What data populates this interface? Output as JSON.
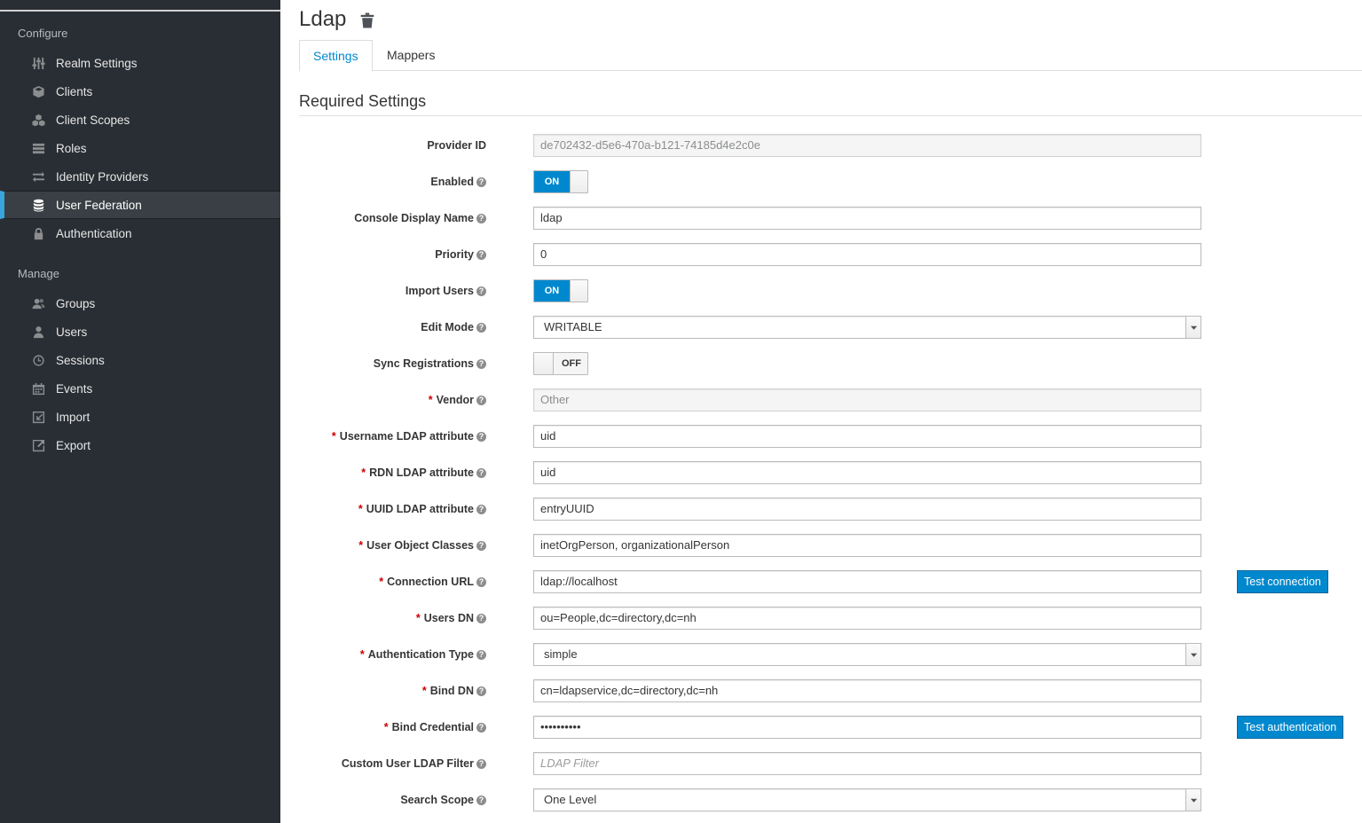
{
  "sidebar": {
    "configure_title": "Configure",
    "manage_title": "Manage",
    "configure_items": [
      {
        "label": "Realm Settings",
        "icon": "sliders-icon"
      },
      {
        "label": "Clients",
        "icon": "cube-icon"
      },
      {
        "label": "Client Scopes",
        "icon": "cubes-icon"
      },
      {
        "label": "Roles",
        "icon": "list-icon"
      },
      {
        "label": "Identity Providers",
        "icon": "exchange-icon"
      },
      {
        "label": "User Federation",
        "icon": "database-icon",
        "active": true
      },
      {
        "label": "Authentication",
        "icon": "lock-icon"
      }
    ],
    "manage_items": [
      {
        "label": "Groups",
        "icon": "users-icon"
      },
      {
        "label": "Users",
        "icon": "user-icon"
      },
      {
        "label": "Sessions",
        "icon": "clock-icon"
      },
      {
        "label": "Events",
        "icon": "calendar-icon"
      },
      {
        "label": "Import",
        "icon": "import-icon"
      },
      {
        "label": "Export",
        "icon": "export-icon"
      }
    ]
  },
  "page": {
    "title": "Ldap",
    "tabs": [
      {
        "label": "Settings",
        "active": true
      },
      {
        "label": "Mappers",
        "active": false
      }
    ],
    "section_heading": "Required Settings"
  },
  "form": {
    "provider_id": {
      "label": "Provider ID",
      "value": "de702432-d5e6-470a-b121-74185d4e2c0e"
    },
    "enabled": {
      "label": "Enabled",
      "state": "ON"
    },
    "console_display_name": {
      "label": "Console Display Name",
      "value": "ldap"
    },
    "priority": {
      "label": "Priority",
      "value": "0"
    },
    "import_users": {
      "label": "Import Users",
      "state": "ON"
    },
    "edit_mode": {
      "label": "Edit Mode",
      "value": "WRITABLE"
    },
    "sync_registrations": {
      "label": "Sync Registrations",
      "state": "OFF"
    },
    "vendor": {
      "label": "Vendor",
      "value": "Other"
    },
    "username_ldap_attribute": {
      "label": "Username LDAP attribute",
      "value": "uid"
    },
    "rdn_ldap_attribute": {
      "label": "RDN LDAP attribute",
      "value": "uid"
    },
    "uuid_ldap_attribute": {
      "label": "UUID LDAP attribute",
      "value": "entryUUID"
    },
    "user_object_classes": {
      "label": "User Object Classes",
      "value": "inetOrgPerson, organizationalPerson"
    },
    "connection_url": {
      "label": "Connection URL",
      "value": "ldap://localhost",
      "button": "Test connection"
    },
    "users_dn": {
      "label": "Users DN",
      "value": "ou=People,dc=directory,dc=nh"
    },
    "authentication_type": {
      "label": "Authentication Type",
      "value": "simple"
    },
    "bind_dn": {
      "label": "Bind DN",
      "value": "cn=ldapservice,dc=directory,dc=nh"
    },
    "bind_credential": {
      "label": "Bind Credential",
      "value": "••••••••••",
      "button": "Test authentication"
    },
    "custom_user_ldap_filter": {
      "label": "Custom User LDAP Filter",
      "placeholder": "LDAP Filter"
    },
    "search_scope": {
      "label": "Search Scope",
      "value": "One Level"
    }
  },
  "colors": {
    "sidebar_bg": "#292e34",
    "accent": "#0088ce",
    "active_border": "#39a5dc",
    "required": "#cc0000"
  }
}
